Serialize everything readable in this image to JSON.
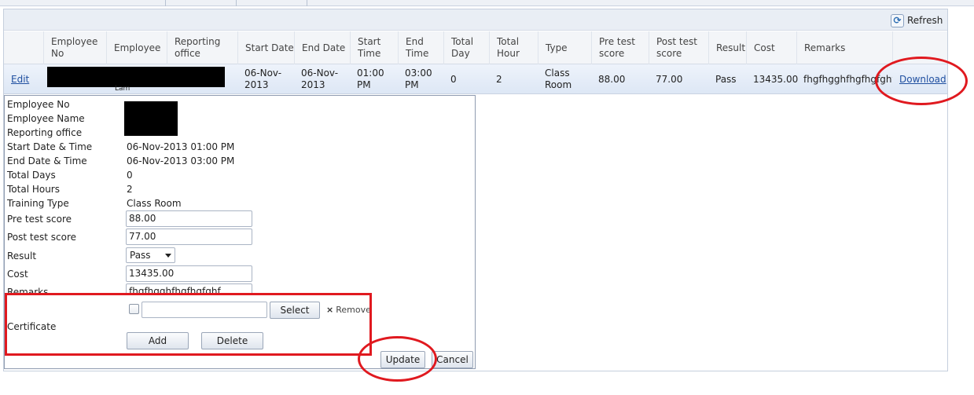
{
  "toolbar": {
    "refresh_label": "Refresh"
  },
  "columns": [
    "",
    "Employee No",
    "Employee",
    "Reporting office",
    "Start Date",
    "End Date",
    "Start Time",
    "End Time",
    "Total Day",
    "Total Hour",
    "Type",
    "Pre test score",
    "Post test score",
    "Result",
    "Cost",
    "Remarks",
    ""
  ],
  "row": {
    "edit": "Edit",
    "employee_partial": "Lam",
    "start_date": "06-Nov-2013",
    "end_date": "06-Nov-2013",
    "start_time": "01:00 PM",
    "end_time": "03:00 PM",
    "total_day": "0",
    "total_hour": "2",
    "type": "Class Room",
    "pre_test_score": "88.00",
    "post_test_score": "77.00",
    "result": "Pass",
    "cost": "13435.00",
    "remarks": "fhgfhgghfhgfhgfghf",
    "download": "Download"
  },
  "form": {
    "labels": {
      "employee_no": "Employee No",
      "employee_name": "Employee Name",
      "reporting_office": "Reporting office",
      "start_datetime": "Start Date & Time",
      "end_datetime": "End Date & Time",
      "total_days": "Total Days",
      "total_hours": "Total Hours",
      "training_type": "Training Type",
      "pre_test_score": "Pre test score",
      "post_test_score": "Post test score",
      "result": "Result",
      "cost": "Cost",
      "remarks": "Remarks",
      "certificate": "Certificate"
    },
    "values": {
      "start_datetime": "06-Nov-2013 01:00 PM",
      "end_datetime": "06-Nov-2013 03:00 PM",
      "total_days": "0",
      "total_hours": "2",
      "training_type": "Class Room",
      "pre_test_score": "88.00",
      "post_test_score": "77.00",
      "result": "Pass",
      "cost": "13435.00",
      "remarks": "fhgfhgghfhgfhgfghf"
    },
    "buttons": {
      "select": "Select",
      "remove": "Remove",
      "add": "Add",
      "delete": "Delete",
      "update": "Update",
      "cancel": "Cancel"
    }
  },
  "colors": {
    "annotation_red": "#e0191f",
    "link_blue": "#1f4fa0",
    "row_highlight": "#dde7f5"
  }
}
